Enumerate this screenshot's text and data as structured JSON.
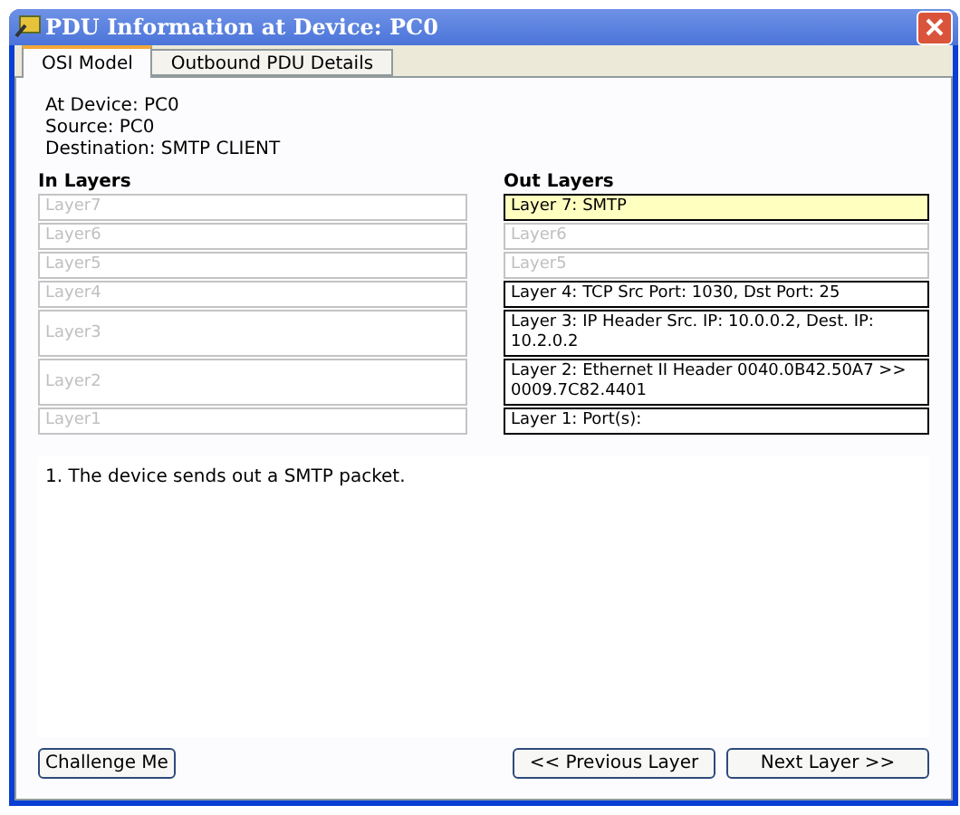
{
  "window": {
    "title": "PDU Information at Device: PC0"
  },
  "tabs": [
    {
      "label": "OSI Model",
      "selected": true
    },
    {
      "label": "Outbound PDU Details",
      "selected": false
    }
  ],
  "info": [
    "At Device: PC0",
    "Source: PC0",
    "Destination: SMTP CLIENT"
  ],
  "in_layers": {
    "heading": "In Layers",
    "layers": [
      {
        "text": "Layer7",
        "active": false,
        "selected": false
      },
      {
        "text": "Layer6",
        "active": false,
        "selected": false
      },
      {
        "text": "Layer5",
        "active": false,
        "selected": false
      },
      {
        "text": "Layer4",
        "active": false,
        "selected": false
      },
      {
        "text": "Layer3",
        "active": false,
        "selected": false
      },
      {
        "text": "Layer2",
        "active": false,
        "selected": false
      },
      {
        "text": "Layer1",
        "active": false,
        "selected": false
      }
    ]
  },
  "out_layers": {
    "heading": "Out Layers",
    "layers": [
      {
        "text": "Layer 7: SMTP",
        "active": true,
        "selected": true
      },
      {
        "text": "Layer6",
        "active": false,
        "selected": false
      },
      {
        "text": "Layer5",
        "active": false,
        "selected": false
      },
      {
        "text": "Layer 4: TCP Src Port: 1030, Dst Port: 25",
        "active": true,
        "selected": false
      },
      {
        "text": "Layer 3: IP Header Src. IP: 10.0.0.2, Dest. IP: 10.2.0.2",
        "active": true,
        "selected": false
      },
      {
        "text": "Layer 2: Ethernet II Header 0040.0B42.50A7 >> 0009.7C82.4401",
        "active": true,
        "selected": false
      },
      {
        "text": "Layer 1: Port(s):",
        "active": true,
        "selected": false
      }
    ]
  },
  "description": "1. The device sends out a SMTP packet.",
  "buttons": {
    "challenge": "Challenge Me",
    "previous": "<< Previous Layer",
    "next": "Next Layer >>"
  }
}
